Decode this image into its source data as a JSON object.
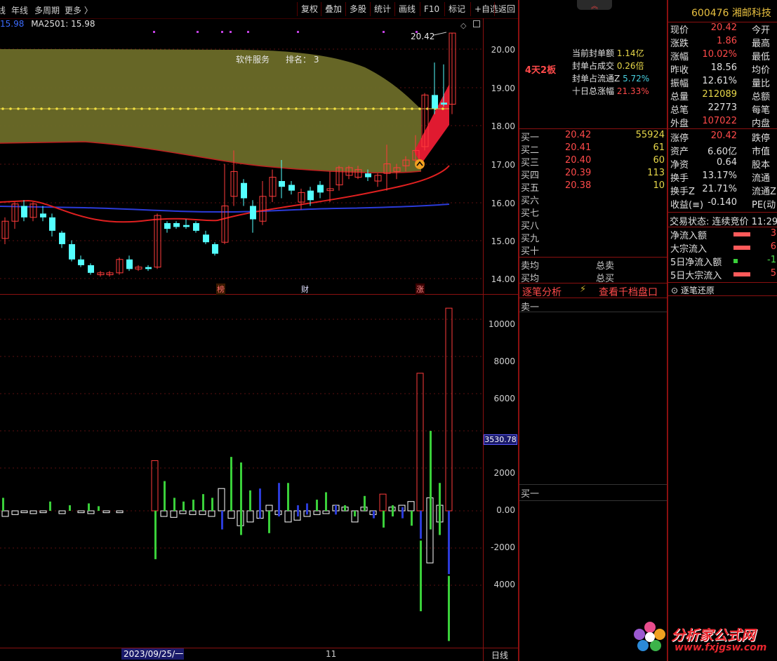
{
  "toolbar": {
    "left_items": [
      "线",
      "年线",
      "多周期",
      "更多 〉"
    ],
    "buttons": [
      "复权",
      "叠加",
      "多股",
      "统计",
      "画线",
      "F10",
      "标记",
      "+自选",
      "返回"
    ]
  },
  "ma_line": {
    "val_prefix": "15.98",
    "label": "MA2501: 15.98"
  },
  "annotations": {
    "sector": "软件服务",
    "rank": "排名： 3",
    "peak_price": "20.42",
    "markers": [
      "榜",
      "财",
      "涨"
    ]
  },
  "price_axis": [
    "20.00",
    "19.00",
    "18.00",
    "17.00",
    "16.00",
    "15.00",
    "14.00"
  ],
  "volume_axis": [
    "10000",
    "8000",
    "6000",
    "4000",
    "2000",
    "0.00",
    "-2000",
    "-4000"
  ],
  "volume_marker": "3530.78",
  "bottom": {
    "date": "2023/09/25/一",
    "month": "11",
    "period": "日线"
  },
  "limit_panel": {
    "badge": "4天2板",
    "rows": [
      {
        "label": "当前封单额",
        "value": "1.14亿"
      },
      {
        "label": "封单占成交",
        "value": "0.26倍"
      },
      {
        "label": "封单占流通Z",
        "value": "5.72%"
      },
      {
        "label": "十日总涨幅",
        "value": "21.33%"
      }
    ]
  },
  "order_book": {
    "bids": [
      {
        "label": "买一",
        "price": "20.42",
        "volume": "55924"
      },
      {
        "label": "买二",
        "price": "20.41",
        "volume": "61"
      },
      {
        "label": "买三",
        "price": "20.40",
        "volume": "60"
      },
      {
        "label": "买四",
        "price": "20.39",
        "volume": "113"
      },
      {
        "label": "买五",
        "price": "20.38",
        "volume": "10"
      },
      {
        "label": "买六",
        "price": "",
        "volume": ""
      },
      {
        "label": "买七",
        "price": "",
        "volume": ""
      },
      {
        "label": "买八",
        "price": "",
        "volume": ""
      },
      {
        "label": "买九",
        "price": "",
        "volume": ""
      },
      {
        "label": "买十",
        "price": "",
        "volume": ""
      }
    ],
    "sell_avg": "卖均",
    "buy_avg": "买均",
    "total_sell": "总卖",
    "total_buy": "总买",
    "tab_analysis": "逐笔分析",
    "tab_depth": "查看千档盘口",
    "sell_one": "卖一",
    "buy_one": "买一"
  },
  "stock": {
    "code_name": "600476 湘邮科技",
    "quotes": [
      {
        "l": "现价",
        "v": "20.42",
        "c": "red",
        "r": "今开"
      },
      {
        "l": "涨跌",
        "v": "1.86",
        "c": "red",
        "r": "最高"
      },
      {
        "l": "涨幅",
        "v": "10.02%",
        "c": "red",
        "r": "最低"
      },
      {
        "l": "昨收",
        "v": "18.56",
        "c": "wht",
        "r": "均价"
      },
      {
        "l": "振幅",
        "v": "12.61%",
        "c": "wht",
        "r": "量比"
      },
      {
        "l": "总量",
        "v": "212089",
        "c": "yel",
        "r": "总额"
      },
      {
        "l": "总笔",
        "v": "22773",
        "c": "wht",
        "r": "每笔"
      },
      {
        "l": "外盘",
        "v": "107022",
        "c": "red",
        "r": "内盘"
      }
    ],
    "quotes2": [
      {
        "l": "涨停",
        "v": "20.42",
        "c": "red",
        "r": "跌停"
      },
      {
        "l": "资产",
        "v": "6.60亿",
        "c": "wht",
        "r": "市值"
      },
      {
        "l": "净资",
        "v": "0.64",
        "c": "wht",
        "r": "股本"
      },
      {
        "l": "换手",
        "v": "13.17%",
        "c": "wht",
        "r": "流通"
      },
      {
        "l": "换手Z",
        "v": "21.71%",
        "c": "wht",
        "r": "流通Z"
      },
      {
        "l": "收益(≡)",
        "v": "-0.140",
        "c": "wht",
        "r": "PE(动"
      }
    ],
    "status": "交易状态: 连续竞价 11:29",
    "flows": [
      {
        "l": "净流入额",
        "v": "3",
        "c": "red"
      },
      {
        "l": "大宗流入",
        "v": "6",
        "c": "red"
      },
      {
        "l": "5日净流入额",
        "v": "-1",
        "c": "grn"
      },
      {
        "l": "5日大宗流入",
        "v": "5",
        "c": "red"
      }
    ],
    "tick_restore": "逐笔还原"
  },
  "watermark": {
    "cn": "分析家公式网",
    "url": "www.fxjgsw.com"
  },
  "colors": {
    "up": "#ff3b3b",
    "down": "#54ffff",
    "ma_red": "#e02020",
    "ma_blue": "#2b3bd8",
    "band": "#7a7a2a",
    "bg": "#000000"
  }
}
